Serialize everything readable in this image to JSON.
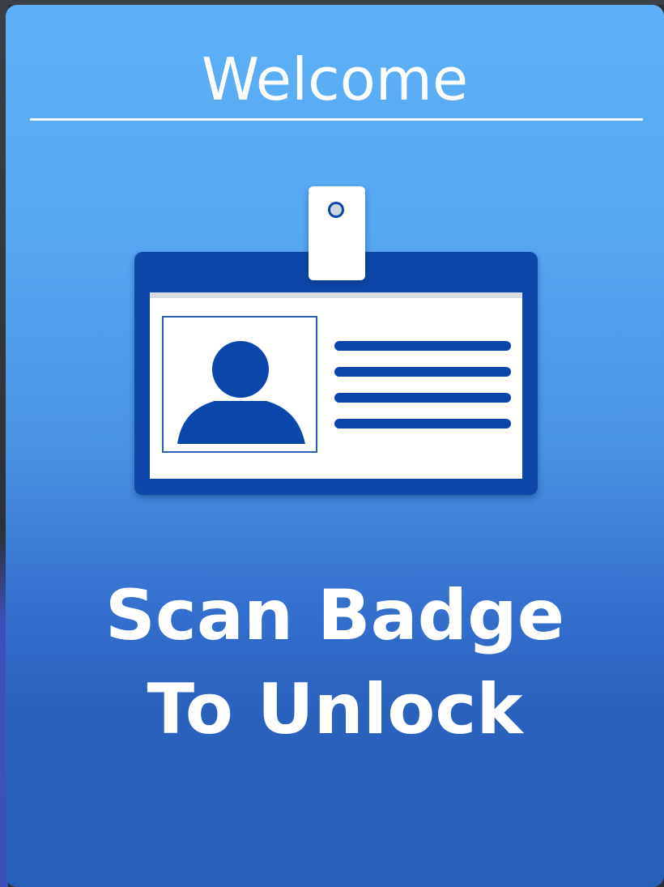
{
  "screen": {
    "title": "Welcome",
    "prompt_line1": "Scan Badge",
    "prompt_line2": "To Unlock",
    "icon": "id-badge-icon"
  },
  "colors": {
    "panel_top": "#5db0f7",
    "panel_bottom": "#2760b8",
    "badge_blue": "#0b47aa",
    "text": "#ffffff"
  }
}
